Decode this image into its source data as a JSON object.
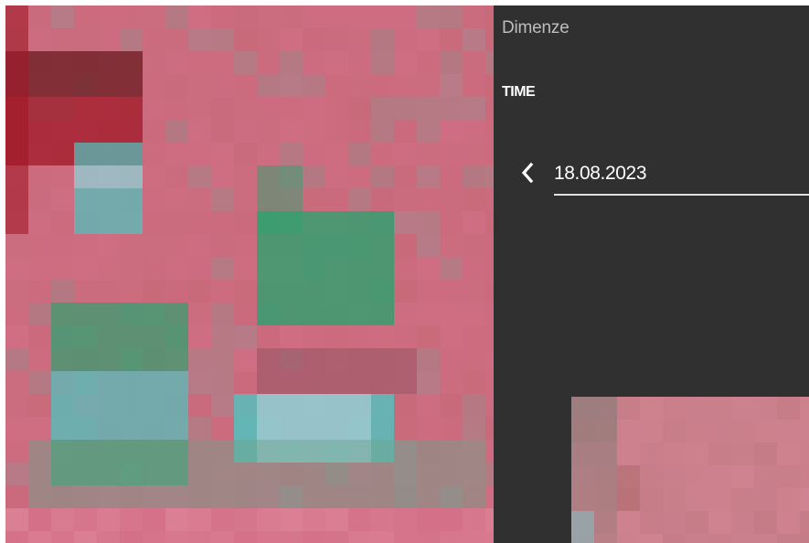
{
  "panel": {
    "title": "Dimenze",
    "dimension_label": "TIME",
    "date_value": "18.08.2023"
  },
  "icons": {
    "prev": "chevron-left-icon"
  },
  "colors": {
    "panel_bg": "#303030",
    "accent_line": "#e0e0e0",
    "map_pink": "#c96a7b",
    "map_green": "#2fa06e",
    "map_cyan": "#4fc4c0",
    "map_red": "#a01826"
  }
}
